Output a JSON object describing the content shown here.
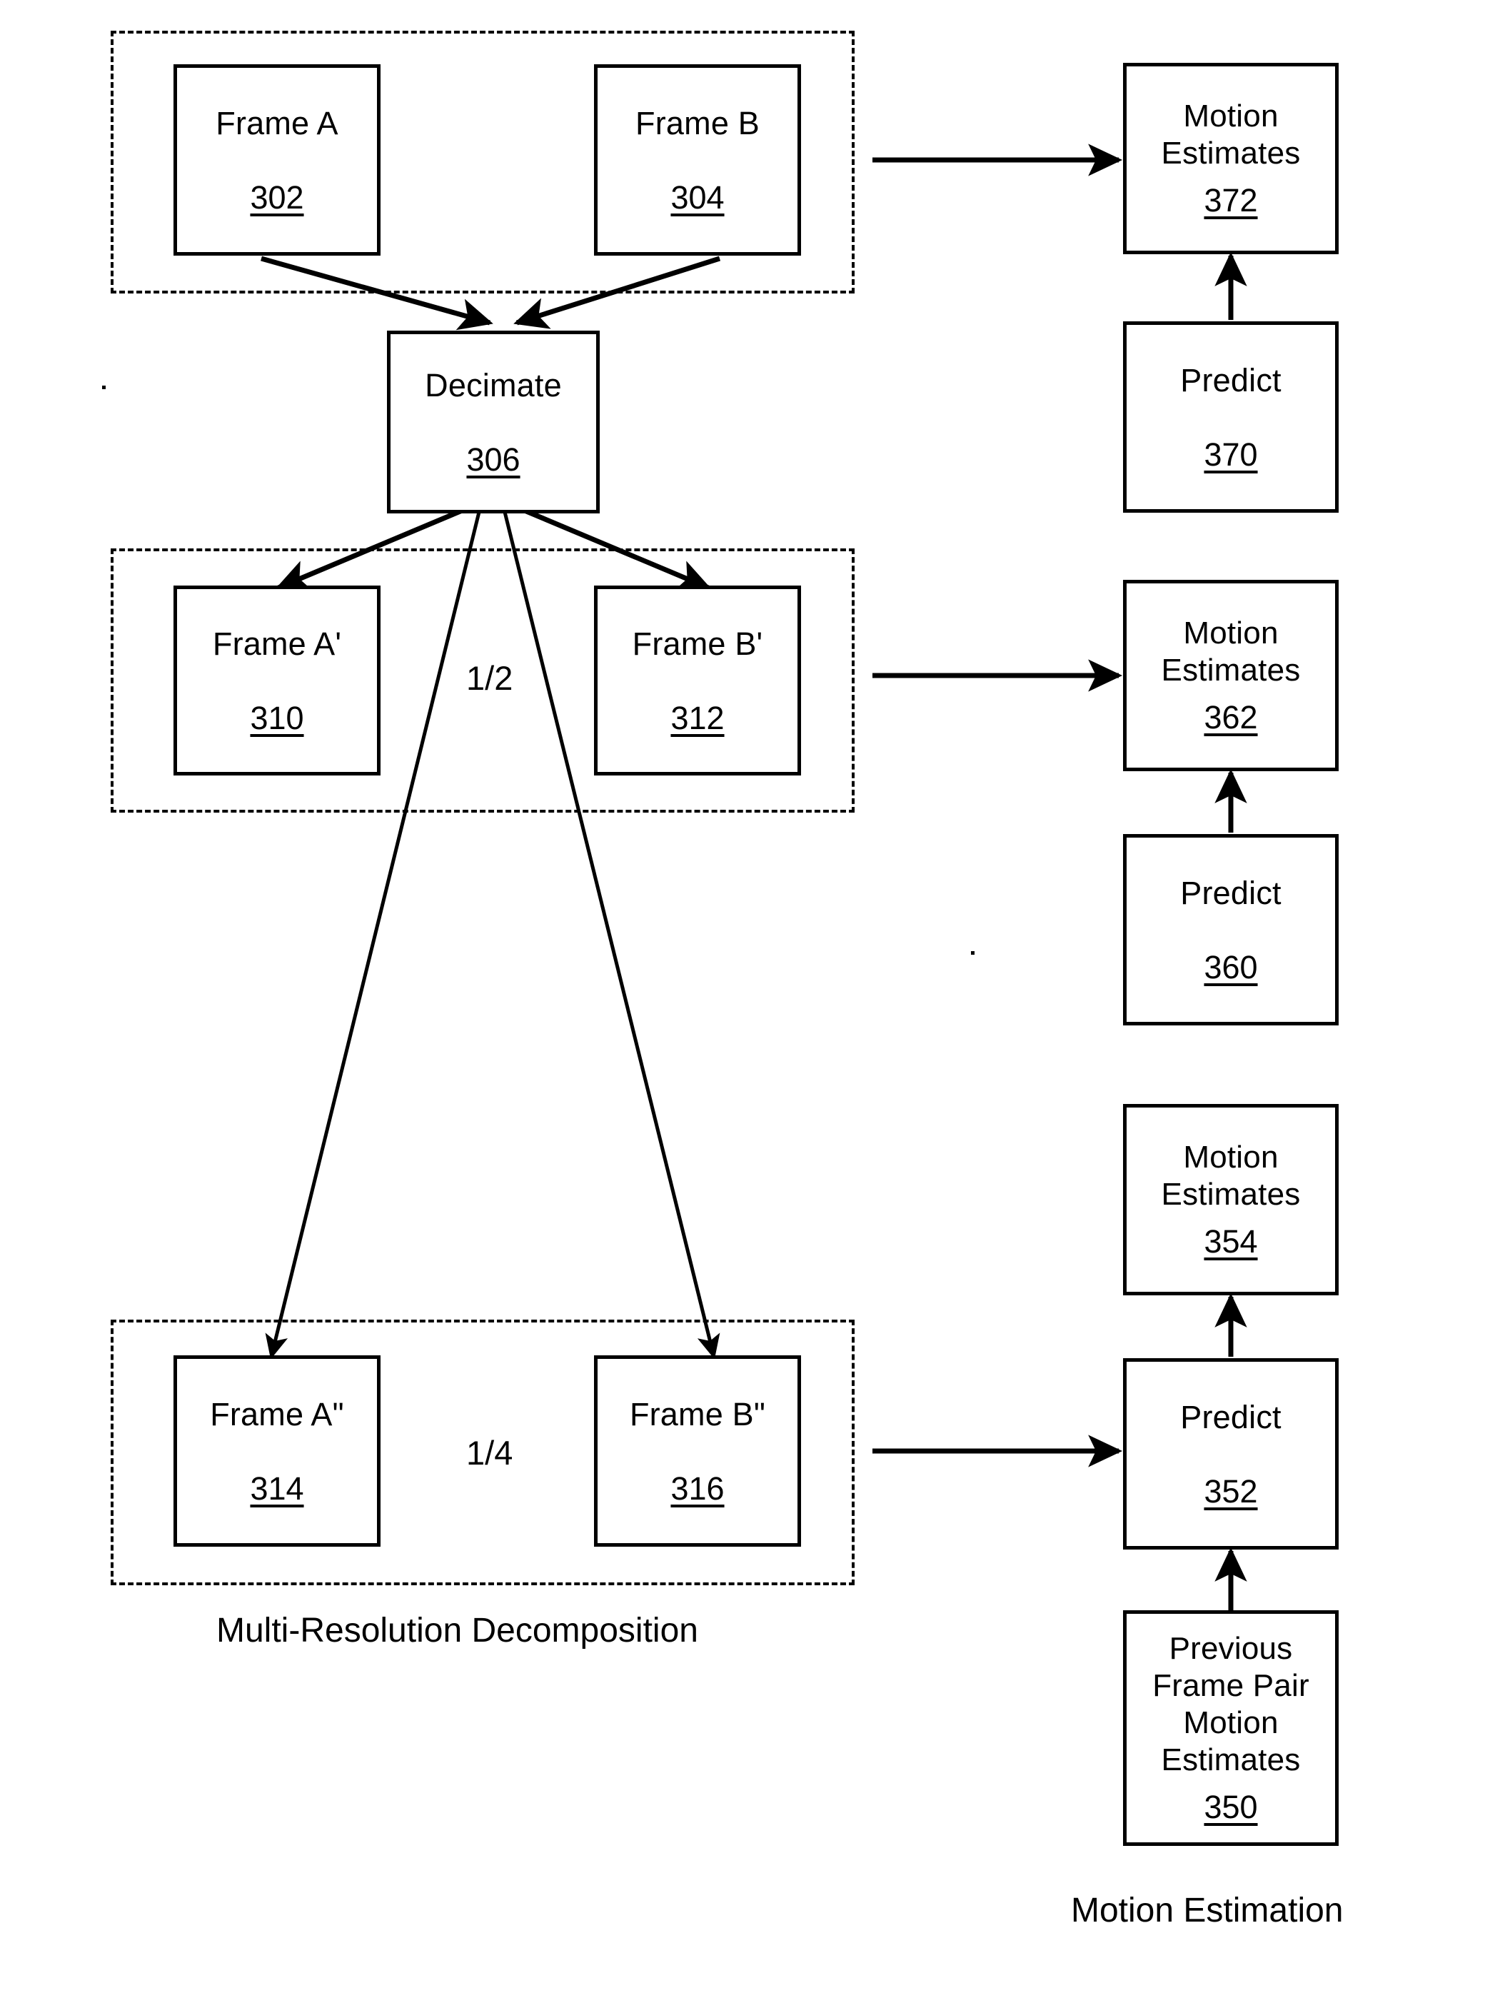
{
  "figure": {
    "type": "patent-flow-diagram",
    "captions": [
      {
        "id": "caption-multi-resolution",
        "text": "Multi-Resolution Decomposition"
      },
      {
        "id": "caption-motion-estimation",
        "text": "Motion Estimation"
      }
    ],
    "ratio_labels": [
      {
        "id": "ratio-half",
        "text": "1/2"
      },
      {
        "id": "ratio-quarter",
        "text": "1/4"
      }
    ],
    "groups": [
      {
        "id": "group-full-resolution",
        "caption": ""
      },
      {
        "id": "group-half-resolution",
        "caption": ""
      },
      {
        "id": "group-quarter-resolution",
        "caption": "Multi-Resolution Decomposition"
      }
    ],
    "nodes": [
      {
        "id": "frame-a",
        "title": "Frame A",
        "ref": "302"
      },
      {
        "id": "frame-b",
        "title": "Frame B",
        "ref": "304"
      },
      {
        "id": "decimate",
        "title": "Decimate",
        "ref": "306"
      },
      {
        "id": "frame-a-prime",
        "title": "Frame A'",
        "ref": "310"
      },
      {
        "id": "frame-b-prime",
        "title": "Frame B'",
        "ref": "312"
      },
      {
        "id": "frame-a-double-prime",
        "title": "Frame A\"",
        "ref": "314"
      },
      {
        "id": "frame-b-double-prime",
        "title": "Frame B\"",
        "ref": "316"
      },
      {
        "id": "motion-estimates-372",
        "title": "Motion\nEstimates",
        "ref": "372"
      },
      {
        "id": "predict-370",
        "title": "Predict",
        "ref": "370"
      },
      {
        "id": "motion-estimates-362",
        "title": "Motion\nEstimates",
        "ref": "362"
      },
      {
        "id": "predict-360",
        "title": "Predict",
        "ref": "360"
      },
      {
        "id": "motion-estimates-354",
        "title": "Motion\nEstimates",
        "ref": "354"
      },
      {
        "id": "predict-352",
        "title": "Predict",
        "ref": "352"
      },
      {
        "id": "previous-frame-pair-motion-estimates-350",
        "title": "Previous\nFrame Pair\nMotion\nEstimates",
        "ref": "350"
      }
    ],
    "edges": [
      {
        "from": "frame-a",
        "to": "decimate"
      },
      {
        "from": "frame-b",
        "to": "decimate"
      },
      {
        "from": "frame-b",
        "to": "motion-estimates-372"
      },
      {
        "from": "decimate",
        "to": "frame-a-prime"
      },
      {
        "from": "decimate",
        "to": "frame-b-prime"
      },
      {
        "from": "decimate",
        "to": "frame-a-double-prime"
      },
      {
        "from": "decimate",
        "to": "frame-b-double-prime"
      },
      {
        "from": "frame-b-prime",
        "to": "motion-estimates-362"
      },
      {
        "from": "frame-b-double-prime",
        "to": "predict-352"
      },
      {
        "from": "previous-frame-pair-motion-estimates-350",
        "to": "predict-352"
      },
      {
        "from": "predict-352",
        "to": "motion-estimates-354"
      },
      {
        "from": "motion-estimates-354",
        "to": "predict-360"
      },
      {
        "from": "predict-360",
        "to": "motion-estimates-362"
      },
      {
        "from": "motion-estimates-362",
        "to": "predict-370"
      },
      {
        "from": "predict-370",
        "to": "motion-estimates-372"
      }
    ],
    "colors": {
      "ink": "#000000",
      "paper": "#ffffff"
    }
  }
}
